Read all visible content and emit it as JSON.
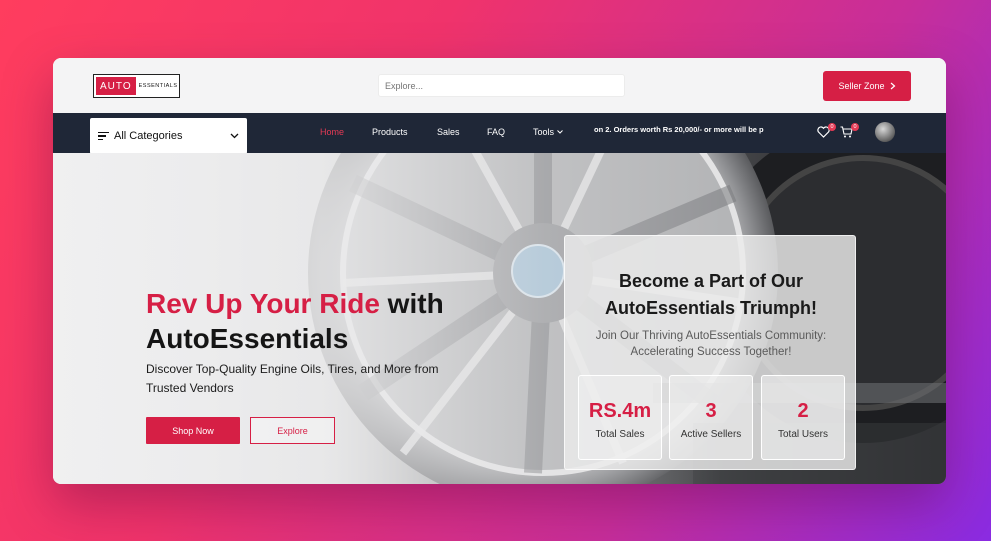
{
  "header": {
    "logo": {
      "brand_main": "AUTO",
      "brand_sub": "ESSENTIALS"
    },
    "search": {
      "placeholder": "Explore..."
    },
    "seller_button": {
      "label": "Seller Zone",
      "icon": "chevron-right-icon"
    }
  },
  "nav": {
    "categories": {
      "label": "All Categories",
      "icon": "menu-lines-icon",
      "chevron": "chevron-down-icon"
    },
    "menu": [
      {
        "label": "Home",
        "active": true
      },
      {
        "label": "Products",
        "active": false
      },
      {
        "label": "Sales",
        "active": false
      },
      {
        "label": "FAQ",
        "active": false
      },
      {
        "label": "Tools",
        "active": false,
        "has_dropdown": true
      }
    ],
    "ticker": "on  2.  Orders worth Rs 20,000/- or more will be p",
    "wishlist": {
      "icon": "heart-icon",
      "count": "0"
    },
    "cart": {
      "icon": "cart-icon",
      "count": "0"
    },
    "avatar": {
      "icon": "user-avatar"
    }
  },
  "hero": {
    "title_red": "Rev Up Your Ride",
    "title_dark_1": " with",
    "title_dark_2": "AutoEssentials",
    "subtitle": "Discover Top-Quality Engine Oils, Tires, and More from Trusted Vendors",
    "shop_button": "Shop Now",
    "explore_button": "Explore"
  },
  "card": {
    "title": "Become a Part of Our AutoEssentials Triumph!",
    "subtitle": "Join Our Thriving AutoEssentials Community: Accelerating Success Together!",
    "stats": [
      {
        "value": "RS.4m",
        "label": "Total Sales"
      },
      {
        "value": "3",
        "label": "Active Sellers"
      },
      {
        "value": "2",
        "label": "Total Users"
      }
    ]
  },
  "colors": {
    "accent": "#d61f45",
    "nav_bg": "#1f2737",
    "active_link": "#e53a55"
  }
}
